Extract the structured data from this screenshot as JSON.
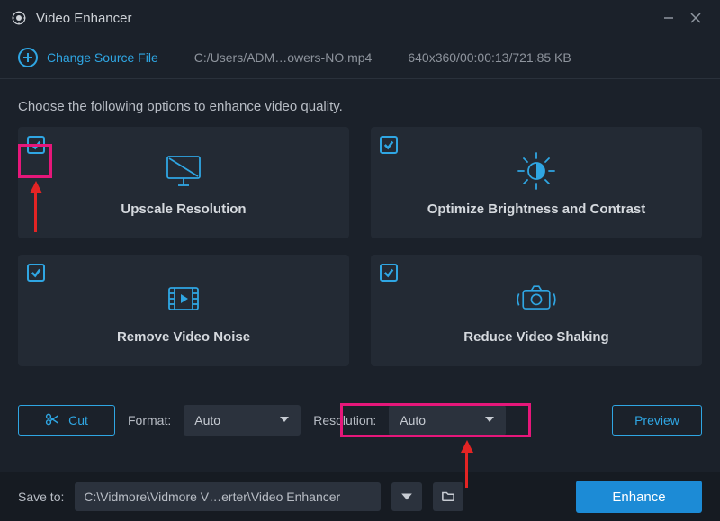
{
  "titlebar": {
    "app_name": "Video Enhancer"
  },
  "source": {
    "change_label": "Change Source File",
    "path": "C:/Users/ADM…owers-NO.mp4",
    "meta": "640x360/00:00:13/721.85 KB"
  },
  "instruction": "Choose the following options to enhance video quality.",
  "cards": [
    {
      "label": "Upscale Resolution",
      "checked": true,
      "icon": "monitor-icon"
    },
    {
      "label": "Optimize Brightness and Contrast",
      "checked": true,
      "icon": "sun-icon"
    },
    {
      "label": "Remove Video Noise",
      "checked": true,
      "icon": "film-icon"
    },
    {
      "label": "Reduce Video Shaking",
      "checked": true,
      "icon": "camera-shake-icon"
    }
  ],
  "controls": {
    "cut_label": "Cut",
    "format_label": "Format:",
    "format_value": "Auto",
    "resolution_label": "Resolution:",
    "resolution_value": "Auto",
    "preview_label": "Preview"
  },
  "bottom": {
    "save_to_label": "Save to:",
    "save_path": "C:\\Vidmore\\Vidmore V…erter\\Video Enhancer",
    "enhance_label": "Enhance"
  },
  "annotations": {
    "highlight_checkbox": true,
    "highlight_resolution": true,
    "arrow_to_checkbox": true,
    "arrow_to_resolution": true
  }
}
